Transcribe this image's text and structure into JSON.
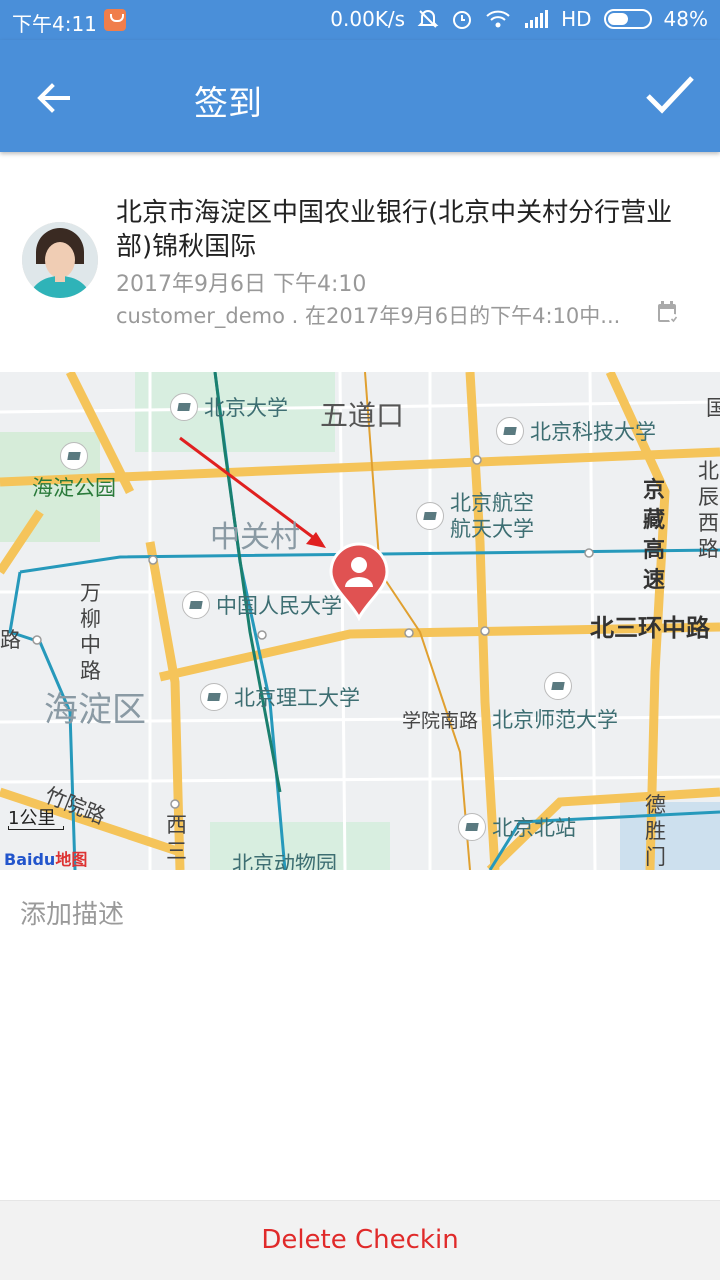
{
  "status": {
    "time": "下午4:11",
    "net_speed": "0.00K/s",
    "signal_type": "HD",
    "battery": "48%"
  },
  "appbar": {
    "title": "签到",
    "back_icon": "arrow-left-icon",
    "done_icon": "checkmark-icon"
  },
  "checkin": {
    "place": "北京市海淀区中国农业银行(北京中关村分行营业部)锦秋国际",
    "datetime": "2017年9月6日 下午4:10",
    "summary": "customer_demo . 在2017年9月6日的下午4:10中...",
    "calendar_icon": "calendar-check-icon"
  },
  "map": {
    "pois": {
      "pku": "北京大学",
      "ustb": "北京科技大学",
      "haidian_park": "海淀公园",
      "buaa_1": "北京航空",
      "buaa_2": "航天大学",
      "ruc": "中国人民大学",
      "bit": "北京理工大学",
      "bnu": "北京师范大学",
      "zoo": "北京动物园",
      "beijing_north": "北京北站"
    },
    "labels": {
      "wudaokou": "五道口",
      "zhongguancun": "中关村",
      "haidian_district": "海淀区",
      "xueyuan_south": "学院南路",
      "north_3rd_ring": "北三环中路",
      "zhuyuan": "竹院路",
      "wanliu": "万柳中路",
      "lu": "路",
      "jingzang": "京藏高速",
      "deshengmen": "德胜门内",
      "xisan": "西三",
      "xichen": "北辰西路",
      "right_edge": "国"
    },
    "scale": "1公里",
    "logo_text": "Baidu",
    "logo_suffix": "地图"
  },
  "description_placeholder": "添加描述",
  "delete_label": "Delete Checkin",
  "colors": {
    "primary": "#4a8fd9",
    "delete": "#e02a2a",
    "pin": "#e05252"
  }
}
